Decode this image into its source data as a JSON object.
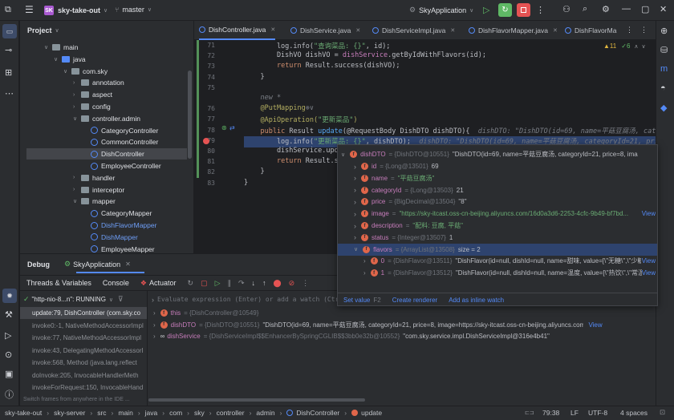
{
  "titlebar": {
    "project_badge": "SK",
    "project_name": "sky-take-out",
    "branch": "master",
    "run_config": "SkyApplication"
  },
  "project_panel": {
    "title": "Project",
    "tree": [
      {
        "label": "main",
        "type": "folder",
        "depth": 3,
        "expanded": true
      },
      {
        "label": "java",
        "type": "folder-blue",
        "depth": 4,
        "expanded": true
      },
      {
        "label": "com.sky",
        "type": "package",
        "depth": 5,
        "expanded": true
      },
      {
        "label": "annotation",
        "type": "package",
        "depth": 6,
        "expanded": false
      },
      {
        "label": "aspect",
        "type": "package",
        "depth": 6,
        "expanded": false
      },
      {
        "label": "config",
        "type": "package",
        "depth": 6,
        "expanded": false
      },
      {
        "label": "controller.admin",
        "type": "package",
        "depth": 6,
        "expanded": true
      },
      {
        "label": "CategoryController",
        "type": "class",
        "depth": 7
      },
      {
        "label": "CommonController",
        "type": "class",
        "depth": 7
      },
      {
        "label": "DishController",
        "type": "class",
        "depth": 7,
        "selected": true
      },
      {
        "label": "EmployeeController",
        "type": "class",
        "depth": 7
      },
      {
        "label": "handler",
        "type": "package",
        "depth": 6,
        "expanded": false
      },
      {
        "label": "interceptor",
        "type": "package",
        "depth": 6,
        "expanded": false
      },
      {
        "label": "mapper",
        "type": "package",
        "depth": 6,
        "expanded": true
      },
      {
        "label": "CategoryMapper",
        "type": "class",
        "depth": 7
      },
      {
        "label": "DishFlavorMapper",
        "type": "class",
        "depth": 7,
        "blue": true
      },
      {
        "label": "DishMapper",
        "type": "class",
        "depth": 7,
        "blue": true
      },
      {
        "label": "EmployeeMapper",
        "type": "class",
        "depth": 7
      }
    ]
  },
  "editor_tabs": [
    {
      "label": "DishController.java",
      "active": true
    },
    {
      "label": "DishService.java"
    },
    {
      "label": "DishServiceImpl.java"
    },
    {
      "label": "DishFlavorMapper.java"
    },
    {
      "label": "DishFlavorMa"
    }
  ],
  "editor": {
    "warnings": "▲11",
    "checks": "✓6",
    "line_numbers": [
      "71",
      "72",
      "73",
      "74",
      "75",
      "",
      "76",
      "77",
      "78",
      "79",
      "80",
      "81",
      "82",
      "83"
    ],
    "code_lines": [
      {
        "parts": [
          {
            "t": "        log.info(",
            "c": ""
          },
          {
            "t": "\"查询菜品: {}\"",
            "c": "str"
          },
          {
            "t": ", id);",
            "c": ""
          }
        ]
      },
      {
        "parts": [
          {
            "t": "        DishVO dishVO = ",
            "c": ""
          },
          {
            "t": "dishService",
            "c": "vname"
          },
          {
            "t": ".getByIdWithFlavors(id);",
            "c": ""
          }
        ]
      },
      {
        "parts": [
          {
            "t": "        ",
            "c": ""
          },
          {
            "t": "return",
            "c": "kw"
          },
          {
            "t": " Result.success(dishVO);",
            "c": ""
          }
        ]
      },
      {
        "parts": [
          {
            "t": "    }",
            "c": ""
          }
        ]
      },
      {
        "parts": [
          {
            "t": "",
            "c": ""
          }
        ]
      },
      {
        "parts": [
          {
            "t": "    new *",
            "c": "cm"
          }
        ]
      },
      {
        "parts": [
          {
            "t": "    @PutMapping",
            "c": "an"
          },
          {
            "t": "⊕∨",
            "c": "cm"
          }
        ]
      },
      {
        "parts": [
          {
            "t": "    @ApiOperation(",
            "c": "an"
          },
          {
            "t": "\"更新菜品\"",
            "c": "str"
          },
          {
            "t": ")",
            "c": "an"
          }
        ]
      },
      {
        "parts": [
          {
            "t": "    ",
            "c": ""
          },
          {
            "t": "public",
            "c": "kw"
          },
          {
            "t": " Result ",
            "c": ""
          },
          {
            "t": "update",
            "c": "fn"
          },
          {
            "t": "(@RequestBody DishDTO dishDTO){  ",
            "c": ""
          },
          {
            "t": "dishDTO: \"DishDTO(id=69, name=平菇豆腐汤, categoryId=21",
            "c": "cm"
          }
        ]
      },
      {
        "parts": [
          {
            "t": "        log.info(",
            "c": ""
          },
          {
            "t": "\"更新菜品: {}\"",
            "c": "str"
          },
          {
            "t": ", dishDTO);  ",
            "c": ""
          },
          {
            "t": "dishDTO: \"DishDTO(id=69, name=平菇豆腐汤, categoryId=21, price=8, ima",
            "c": "cm"
          }
        ],
        "highlight": true
      },
      {
        "parts": [
          {
            "t": "        dishService.upda",
            "c": ""
          }
        ]
      },
      {
        "parts": [
          {
            "t": "        ",
            "c": ""
          },
          {
            "t": "return",
            "c": "kw"
          },
          {
            "t": " Result.suc",
            "c": ""
          }
        ]
      },
      {
        "parts": [
          {
            "t": "    }",
            "c": ""
          }
        ]
      },
      {
        "parts": [
          {
            "t": "}",
            "c": ""
          }
        ]
      }
    ]
  },
  "debug": {
    "title": "Debug",
    "config": "SkyApplication",
    "tabs": [
      "Threads & Variables",
      "Console",
      "Actuator"
    ],
    "thread": "\"http-nio-8...n\": RUNNING",
    "frames": [
      {
        "label": "update:79, DishController (com.sky.co",
        "active": true
      },
      {
        "label": "invoke0:-1, NativeMethodAccessorImpl"
      },
      {
        "label": "invoke:77, NativeMethodAccessorImpl"
      },
      {
        "label": "invoke:43, DelegatingMethodAccessorI"
      },
      {
        "label": "invoke:568, Method (java.lang.reflect"
      },
      {
        "label": "doInvoke:205, InvocableHandlerMeth"
      },
      {
        "label": "invokeForRequest:150, InvocableHand"
      }
    ],
    "frames_hint": "Switch frames from anywhere in the IDE ...",
    "eval_placeholder": "Evaluate expression (Enter) or add a watch (Ctrl+Shift+Enter)",
    "variables": [
      {
        "name": "this",
        "type": "= {DishController@10549}",
        "value": ""
      },
      {
        "name": "dishDTO",
        "type": "= {DishDTO@10551}",
        "value": "\"DishDTO(id=69, name=平菇豆腐汤, categoryId=21, price=8, image=https://sky-itcast.oss-cn-beijing.aliyuncs.com/16d0...",
        "link": "View"
      },
      {
        "name": "dishService",
        "type": "= {DishServiceImpl$$EnhancerBySpringCGLIB$$3bb0e32b@10552}",
        "value": "\"com.sky.service.impl.DishServiceImpl@316e4b41\""
      }
    ]
  },
  "popup": {
    "root": {
      "name": "dishDTO",
      "type": "= {DishDTO@10551}",
      "value": "\"DishDTO(id=69, name=平菇豆腐汤, categoryId=21, price=8, ima"
    },
    "fields": [
      {
        "name": "id",
        "type": "= {Long@13501}",
        "value": "69",
        "kind": "num"
      },
      {
        "name": "name",
        "type": "=",
        "value": "\"平菇豆腐汤\"",
        "kind": "str"
      },
      {
        "name": "categoryId",
        "type": "= {Long@13503}",
        "value": "21",
        "kind": "num"
      },
      {
        "name": "price",
        "type": "= {BigDecimal@13504}",
        "value": "\"8\"",
        "kind": ""
      },
      {
        "name": "image",
        "type": "=",
        "value": "\"https://sky-itcast.oss-cn-beijing.aliyuncs.com/16d0a3d6-2253-4cfc-9b49-bf7bd...",
        "kind": "str",
        "link": "View"
      },
      {
        "name": "description",
        "type": "=",
        "value": "\"配料: 豆腐, 平菇\"",
        "kind": "str"
      },
      {
        "name": "status",
        "type": "= {Integer@13507}",
        "value": "1",
        "kind": "num"
      },
      {
        "name": "flavors",
        "type": "= {ArrayList@13508}",
        "value": "size = 2",
        "kind": "",
        "selected": true
      }
    ],
    "children": [
      {
        "name": "0",
        "type": "= {DishFlavor@13511}",
        "value": "\"DishFlavor(id=null, dishId=null, name=甜味, value=[\\\"无糖\\\",\\\"少糖\\\"...",
        "link": "View"
      },
      {
        "name": "1",
        "type": "= {DishFlavor@13512}",
        "value": "\"DishFlavor(id=null, dishId=null, name=温度, value=[\\\"热饮\\\",\\\"常温\\\"...",
        "link": "View"
      }
    ],
    "actions": {
      "set_value": "Set value",
      "set_value_key": "F2",
      "create_renderer": "Create renderer",
      "inline_watch": "Add as inline watch"
    }
  },
  "statusbar": {
    "crumbs": [
      "sky-take-out",
      "sky-server",
      "src",
      "main",
      "java",
      "com",
      "sky",
      "controller",
      "admin",
      "DishController",
      "update"
    ],
    "position": "79:38",
    "line_sep": "LF",
    "encoding": "UTF-8",
    "indent": "4 spaces"
  },
  "colors": {
    "accent": "#548af7",
    "run_green": "#5fb865",
    "stop_red": "#e55353",
    "highlight_line": "#2e436e"
  }
}
